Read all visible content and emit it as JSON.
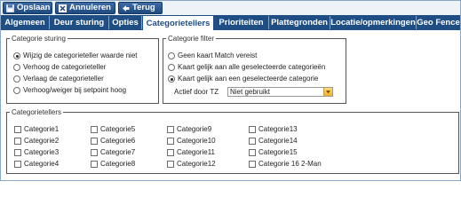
{
  "toolbar": {
    "save_label": "Opslaan",
    "cancel_label": "Annuleren",
    "back_label": "Terug"
  },
  "tabs": [
    {
      "label": "Algemeen"
    },
    {
      "label": "Deur sturing"
    },
    {
      "label": "Opties"
    },
    {
      "label": "Categorietellers",
      "active": true
    },
    {
      "label": "Prioriteiten"
    },
    {
      "label": "Plattegronden"
    },
    {
      "label": "Locatie/opmerkingen"
    },
    {
      "label": "Geo Fence"
    }
  ],
  "categorie_sturing": {
    "legend": "Categorie sturing",
    "options": [
      {
        "label": "Wijzig de categorieteller waarde niet",
        "selected": true
      },
      {
        "label": "Verhoog de categorieteller",
        "selected": false
      },
      {
        "label": "Verlaag de categorieteller",
        "selected": false
      },
      {
        "label": "Verhoog/weiger bij setpoint hoog",
        "selected": false
      }
    ]
  },
  "categorie_filter": {
    "legend": "Categorie filter",
    "options": [
      {
        "label": "Geen kaart Match vereist",
        "selected": false
      },
      {
        "label": "Kaart gelijk aan alle geselecteerde categorieën",
        "selected": false
      },
      {
        "label": "Kaart gelijk aan een geselecteerde categorie",
        "selected": true
      }
    ],
    "actief_label": "Actief door TZ",
    "actief_value": "Niet gebruikt"
  },
  "categorietellers": {
    "legend": "Categorietellers",
    "items": [
      "Categorie1",
      "Categorie2",
      "Categorie3",
      "Categorie4",
      "Categorie5",
      "Categorie6",
      "Categorie7",
      "Categorie8",
      "Categorie9",
      "Categorie10",
      "Categorie11",
      "Categorie12",
      "Categorie13",
      "Categorie14",
      "Categorie15",
      "Categorie 16 2-Man"
    ]
  },
  "colors": {
    "tab_bar": "#1f4e84",
    "button": "#2d5a92",
    "select_arrow": "#f2b224"
  }
}
